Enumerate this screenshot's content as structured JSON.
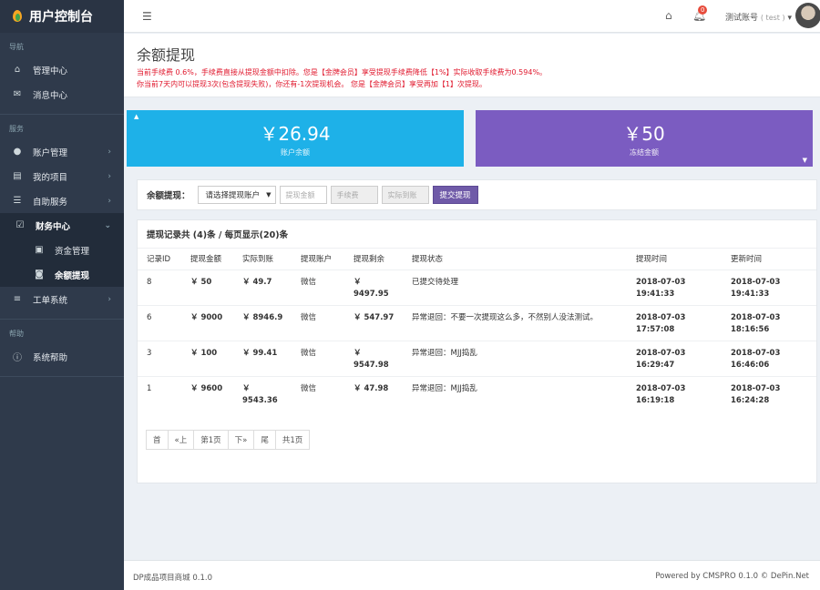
{
  "app": {
    "title": "用户控制台"
  },
  "sidebar": {
    "header_nav": "导航",
    "header_service": "服务",
    "header_help": "帮助",
    "items": {
      "admin_center": "管理中心",
      "message_center": "消息中心",
      "account_mgmt": "账户管理",
      "my_projects": "我的项目",
      "self_service": "自助服务",
      "finance_center": "财务中心",
      "fund_mgmt": "资金管理",
      "balance_withdraw": "余额提现",
      "ticket_system": "工单系统",
      "system_help": "系统帮助"
    }
  },
  "topbar": {
    "badge": "0",
    "user_name": "测试账号",
    "user_tag": "( test )"
  },
  "page": {
    "title": "余额提现",
    "notice_1": "当前手续费 0.6%，手续费直接从提现金额中扣除。您是【金牌会员】享受提现手续费降低【1%】实际收取手续费为0.594%。",
    "notice_2": "你当前7天内可以提现3次(包含提现失败)，你还有-1次提现机会。 您是【金牌会员】享受再加【1】次提现。"
  },
  "stats": {
    "balance_value": "￥26.94",
    "balance_label": "账户余额",
    "frozen_value": "￥50",
    "frozen_label": "冻结金额"
  },
  "form": {
    "label": "余额提现：",
    "select_value": "请选择提现账户",
    "amount_placeholder": "提现金额",
    "fee_placeholder": "手续费",
    "actual_placeholder": "实际到账",
    "submit": "提交提现"
  },
  "records": {
    "title": "提现记录共 (4)条 / 每页显示(20)条",
    "headers": {
      "id": "记录ID",
      "amount": "提现金额",
      "actual": "实际到账",
      "account": "提现账户",
      "remaining": "提现剩余",
      "status": "提现状态",
      "time": "提现时间",
      "updated": "更新时间"
    },
    "rows": [
      {
        "id": "8",
        "amount": "￥ 50",
        "actual": "￥ 49.7",
        "account": "微信",
        "remaining": "￥ 9497.95",
        "status": "已提交待处理",
        "time": "2018-07-03 19:41:33",
        "updated": "2018-07-03 19:41:33"
      },
      {
        "id": "6",
        "amount": "￥ 9000",
        "actual": "￥ 8946.9",
        "account": "微信",
        "remaining": "￥ 547.97",
        "status": "异常退回：不要一次提现这么多，不然别人没法测试。",
        "time": "2018-07-03 17:57:08",
        "updated": "2018-07-03 18:16:56"
      },
      {
        "id": "3",
        "amount": "￥ 100",
        "actual": "￥ 99.41",
        "account": "微信",
        "remaining": "￥ 9547.98",
        "status": "异常退回：MJJ捣乱",
        "time": "2018-07-03 16:29:47",
        "updated": "2018-07-03 16:46:06"
      },
      {
        "id": "1",
        "amount": "￥ 9600",
        "actual": "￥ 9543.36",
        "account": "微信",
        "remaining": "￥ 47.98",
        "status": "异常退回：MJJ捣乱",
        "time": "2018-07-03 16:19:18",
        "updated": "2018-07-03 16:24:28"
      }
    ]
  },
  "pager": {
    "first": "首",
    "prev": "«上",
    "page": "第1页",
    "next": "下»",
    "last": "尾",
    "total": "共1页"
  },
  "footer": {
    "left": "DP成品项目商城 0.1.0",
    "right": "Powered by CMSPRO 0.1.0 © DePin.Net"
  }
}
